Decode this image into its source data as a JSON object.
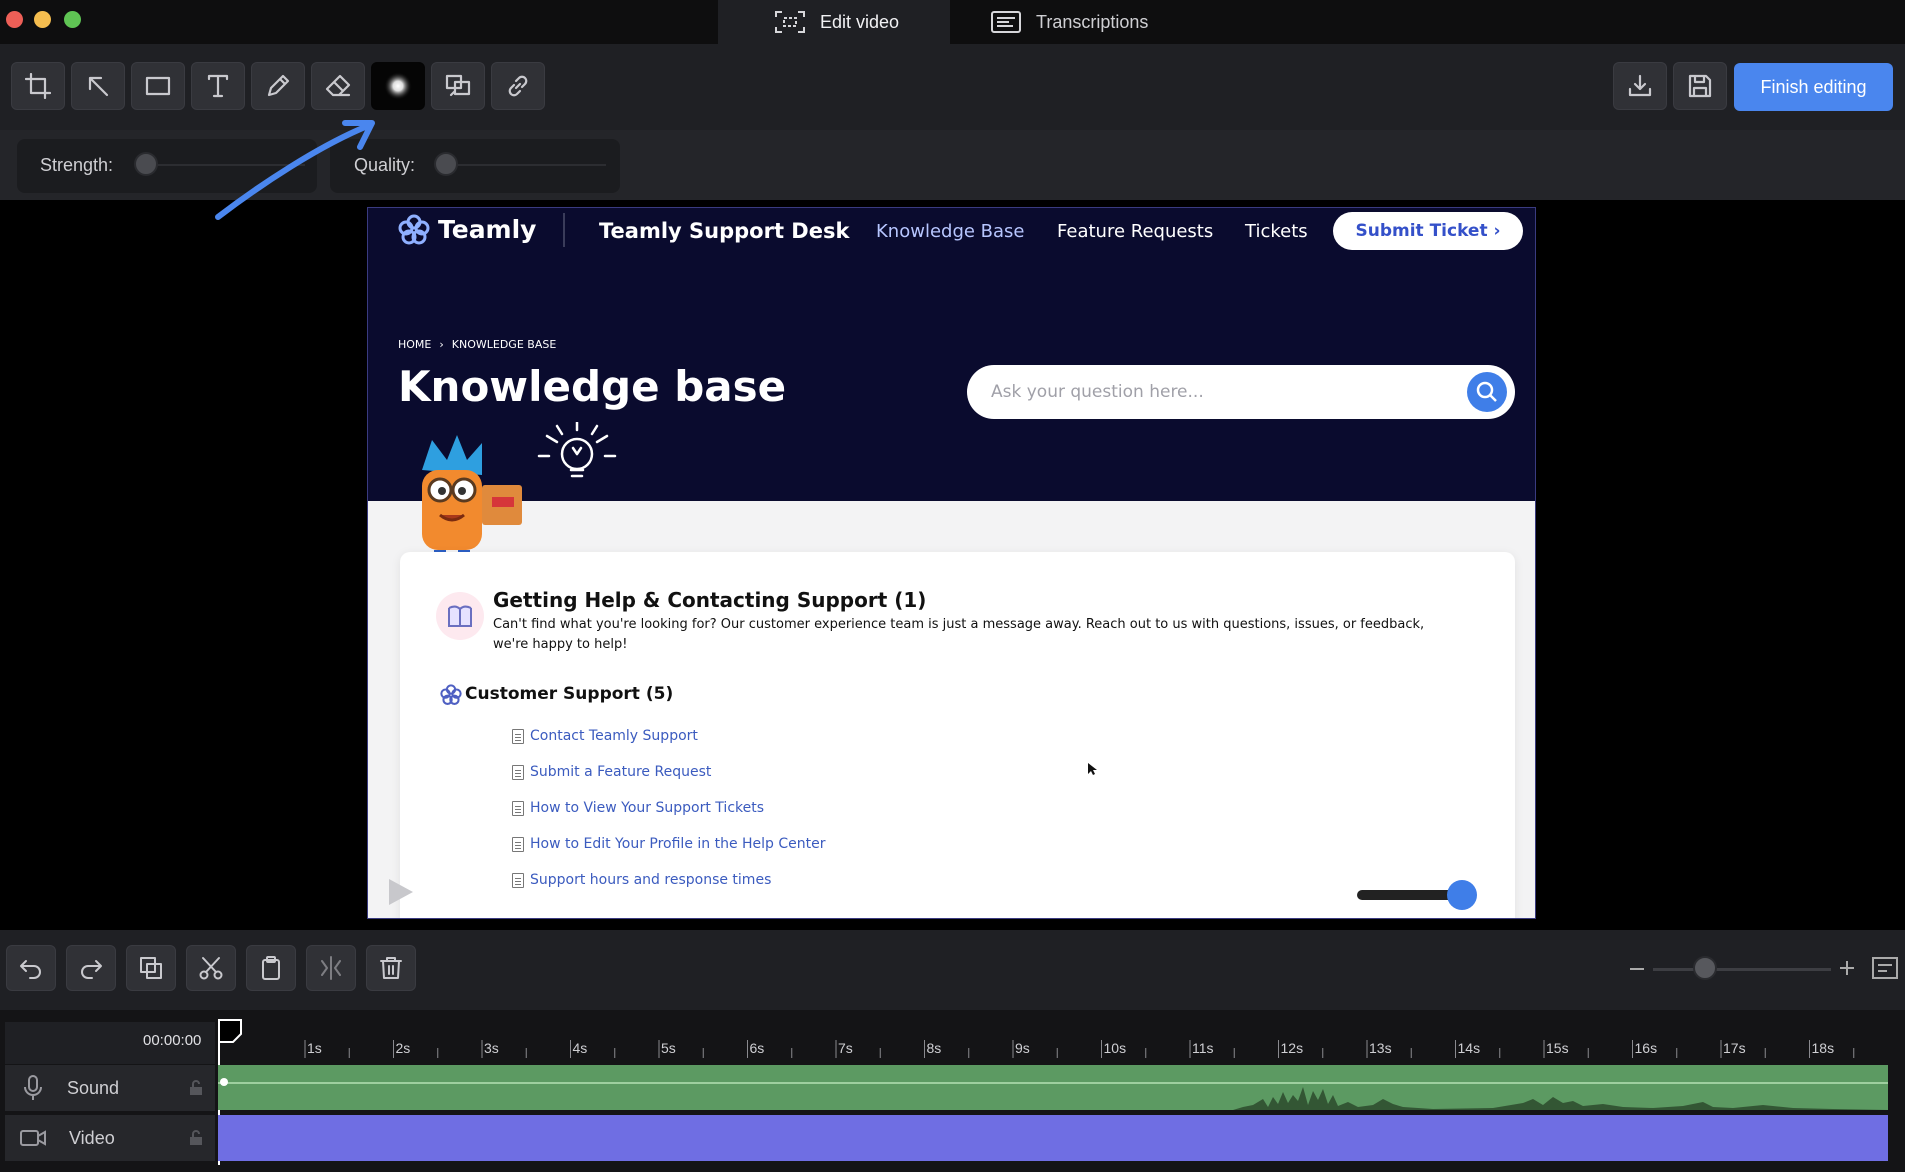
{
  "tabs": [
    {
      "label": "Edit video",
      "icon": "screen-select-icon",
      "active": true
    },
    {
      "label": "Transcriptions",
      "icon": "transcript-icon",
      "active": false
    }
  ],
  "toolbar": {
    "tools": [
      "crop-icon",
      "arrow-icon",
      "rectangle-icon",
      "text-icon",
      "pencil-icon",
      "eraser-icon",
      "blur-icon",
      "spotlight-icon",
      "link-icon"
    ],
    "finish_label": "Finish editing"
  },
  "options": {
    "strength_label": "Strength:",
    "quality_label": "Quality:"
  },
  "preview": {
    "brand": "Teamly",
    "site_title": "Teamly Support Desk",
    "nav": [
      "Knowledge Base",
      "Feature Requests",
      "Tickets"
    ],
    "submit_button": "Submit Ticket ›",
    "breadcrumb_home": "HOME",
    "breadcrumb_current": "KNOWLEDGE BASE",
    "page_heading": "Knowledge base",
    "search_placeholder": "Ask your question here...",
    "section_title": "Getting Help & Contacting Support (1)",
    "section_desc_1": "Can't find what you're looking for? Our customer experience team is just a message away. Reach out to us with questions, issues, or feedback,",
    "section_desc_2": "we're happy to help!",
    "category_title": "Customer Support (5)",
    "articles": [
      "Contact Teamly Support",
      "Submit a Feature Request",
      "How to View Your Support Tickets",
      "How to Edit Your Profile in the Help Center",
      "Support hours and response times"
    ]
  },
  "timeline": {
    "current_time": "00:00:00",
    "ticks": [
      "1s",
      "2s",
      "3s",
      "4s",
      "5s",
      "6s",
      "7s",
      "8s",
      "9s",
      "10s",
      "11s",
      "12s",
      "13s",
      "14s",
      "15s",
      "16s",
      "17s",
      "18s"
    ],
    "tracks": [
      {
        "name": "Sound",
        "icon": "microphone-icon"
      },
      {
        "name": "Video",
        "icon": "video-camera-icon"
      }
    ]
  },
  "colors": {
    "accent": "#4a86ee",
    "sound_track": "#5c9a62",
    "video_track": "#6f6ee3",
    "hero_bg": "#0a0b2e"
  }
}
